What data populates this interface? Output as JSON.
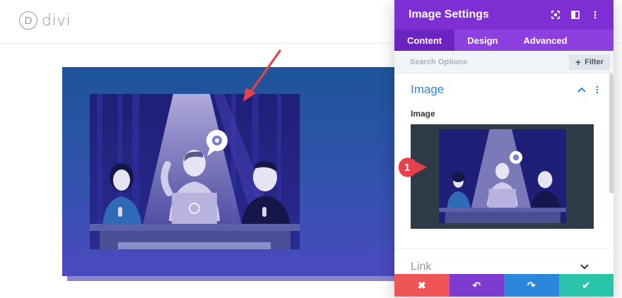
{
  "app": {
    "logo_letter": "D",
    "logo_text": "divi"
  },
  "panel": {
    "title": "Image Settings",
    "header_icons": [
      "expand-icon",
      "split-view-icon",
      "more-icon"
    ],
    "tabs": [
      {
        "label": "Content",
        "active": true
      },
      {
        "label": "Design",
        "active": false
      },
      {
        "label": "Advanced",
        "active": false
      }
    ],
    "search": {
      "placeholder": "Search Options",
      "value": ""
    },
    "filter_label": "Filter",
    "filter_icon": "+",
    "sections": {
      "image": {
        "title": "Image",
        "field_label": "Image",
        "expanded": true
      },
      "link": {
        "title": "Link",
        "expanded": false
      }
    },
    "footer": {
      "discard_glyph": "✖",
      "undo_glyph": "↶",
      "redo_glyph": "↷",
      "save_glyph": "✔"
    }
  },
  "annotation": {
    "step_number": "1"
  },
  "colors": {
    "brand_purple": "#7e2fd4",
    "tab_purple": "#8e3fe0",
    "accent_blue": "#2b87da",
    "discard_red": "#ef5555",
    "save_teal": "#29c4a9",
    "annotation_red": "#e8404a"
  }
}
